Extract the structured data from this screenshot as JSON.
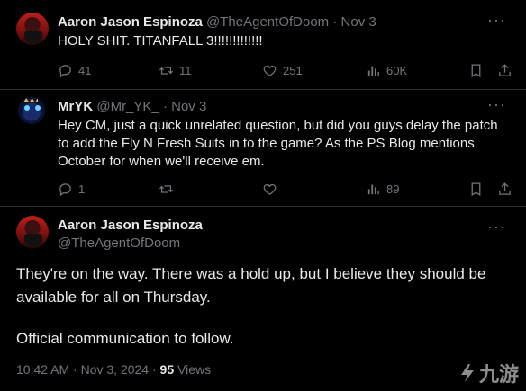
{
  "tweet1": {
    "name": "Aaron Jason Espinoza",
    "handle": "@TheAgentOfDoom",
    "dot": "·",
    "date": "Nov 3",
    "text": "HOLY SHIT. TITANFALL 3!!!!!!!!!!!!!",
    "replies": "41",
    "retweets": "11",
    "likes": "251",
    "views": "60K"
  },
  "tweet2": {
    "name": "MrYK",
    "handle": "@Mr_YK_",
    "dot": "·",
    "date": "Nov 3",
    "text": "Hey CM, just a quick unrelated question, but did you guys delay the patch to add the Fly N Fresh Suits in to the game? As the PS Blog mentions October for when we'll receive em.",
    "replies": "1",
    "retweets": "",
    "likes": "",
    "views": "89"
  },
  "main": {
    "name": "Aaron Jason Espinoza",
    "handle": "@TheAgentOfDoom",
    "text1": "They're on the way. There was a hold up, but I believe they should be available for all on Thursday.",
    "text2": "Official communication to follow.",
    "time": "10:42 AM · Nov 3, 2024 ·",
    "views_count": "95",
    "views_label": "Views"
  },
  "watermark": {
    "text": "九游"
  },
  "icons": [
    "reply-icon",
    "retweet-icon",
    "like-icon",
    "views-icon",
    "bookmark-icon",
    "share-icon",
    "more-icon"
  ]
}
